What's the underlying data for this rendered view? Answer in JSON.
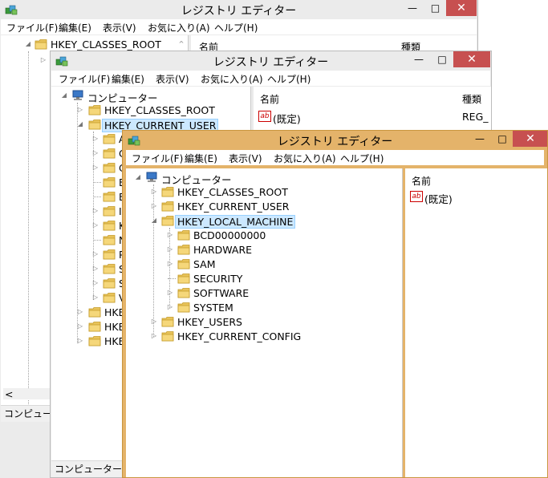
{
  "window1": {
    "title": "レジストリ エディター",
    "menus": [
      "ファイル(F)",
      "編集(E)",
      "表示(V)",
      "お気に入り(A)",
      "ヘルプ(H)"
    ],
    "tree": [
      "HKEY_CLASSES_ROOT"
    ],
    "columns": [
      "名前",
      "種類"
    ],
    "scroll_left": "<",
    "status": "コンピューター"
  },
  "window2": {
    "title": "レジストリ エディター",
    "menus": [
      "ファイル(F)",
      "編集(E)",
      "表示(V)",
      "お気に入り(A)",
      "ヘルプ(H)"
    ],
    "tree": {
      "computer": "コンピューター",
      "keys": [
        "HKEY_CLASSES_ROOT",
        "HKEY_CURRENT_USER"
      ],
      "sub_letters": [
        "A",
        "C",
        "C",
        "E",
        "E",
        "I",
        "K",
        "N",
        "P",
        "S",
        "S",
        "V"
      ],
      "more_keys": [
        "HKE",
        "HKE",
        "HKE"
      ]
    },
    "columns": [
      "名前",
      "種類"
    ],
    "values": [
      {
        "name": "(既定)",
        "type": "REG_"
      }
    ],
    "status": "コンピューター¥HK"
  },
  "window3": {
    "title": "レジストリ エディター",
    "menus": [
      "ファイル(F)",
      "編集(E)",
      "表示(V)",
      "お気に入り(A)",
      "ヘルプ(H)"
    ],
    "tree": {
      "computer": "コンピューター",
      "keys": [
        "HKEY_CLASSES_ROOT",
        "HKEY_CURRENT_USER",
        "HKEY_LOCAL_MACHINE"
      ],
      "sub": [
        "BCD00000000",
        "HARDWARE",
        "SAM",
        "SECURITY",
        "SOFTWARE",
        "SYSTEM"
      ],
      "more_keys": [
        "HKEY_USERS",
        "HKEY_CURRENT_CONFIG"
      ]
    },
    "columns": [
      "名前"
    ],
    "values": [
      {
        "name": "(既定)"
      }
    ]
  },
  "controls": {
    "minimize": "—",
    "maximize": "□",
    "close": "✕"
  },
  "colors": {
    "active_frame": "#e4b36a",
    "inactive_frame": "#ebebeb",
    "close": "#c75050",
    "selection": "#cce8ff"
  },
  "icons": {
    "expanded": "◢",
    "collapsed": "▷",
    "folder": "folder-icon",
    "computer": "computer-icon"
  }
}
